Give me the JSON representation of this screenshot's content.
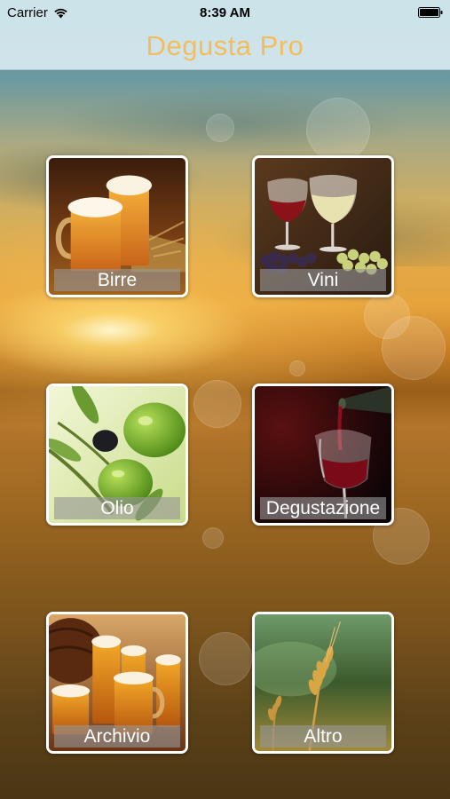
{
  "status_bar": {
    "carrier": "Carrier",
    "time": "8:39 AM"
  },
  "nav": {
    "title": "Degusta Pro",
    "title_color": "#f3bd5e"
  },
  "tiles": [
    {
      "label": "Birre",
      "icon": "beer-glasses-image"
    },
    {
      "label": "Vini",
      "icon": "wine-glasses-grapes-image"
    },
    {
      "label": "Olio",
      "icon": "olives-image"
    },
    {
      "label": "Degustazione",
      "icon": "wine-pouring-image"
    },
    {
      "label": "Archivio",
      "icon": "beer-mugs-barrel-image"
    },
    {
      "label": "Altro",
      "icon": "wheat-ears-image"
    }
  ]
}
